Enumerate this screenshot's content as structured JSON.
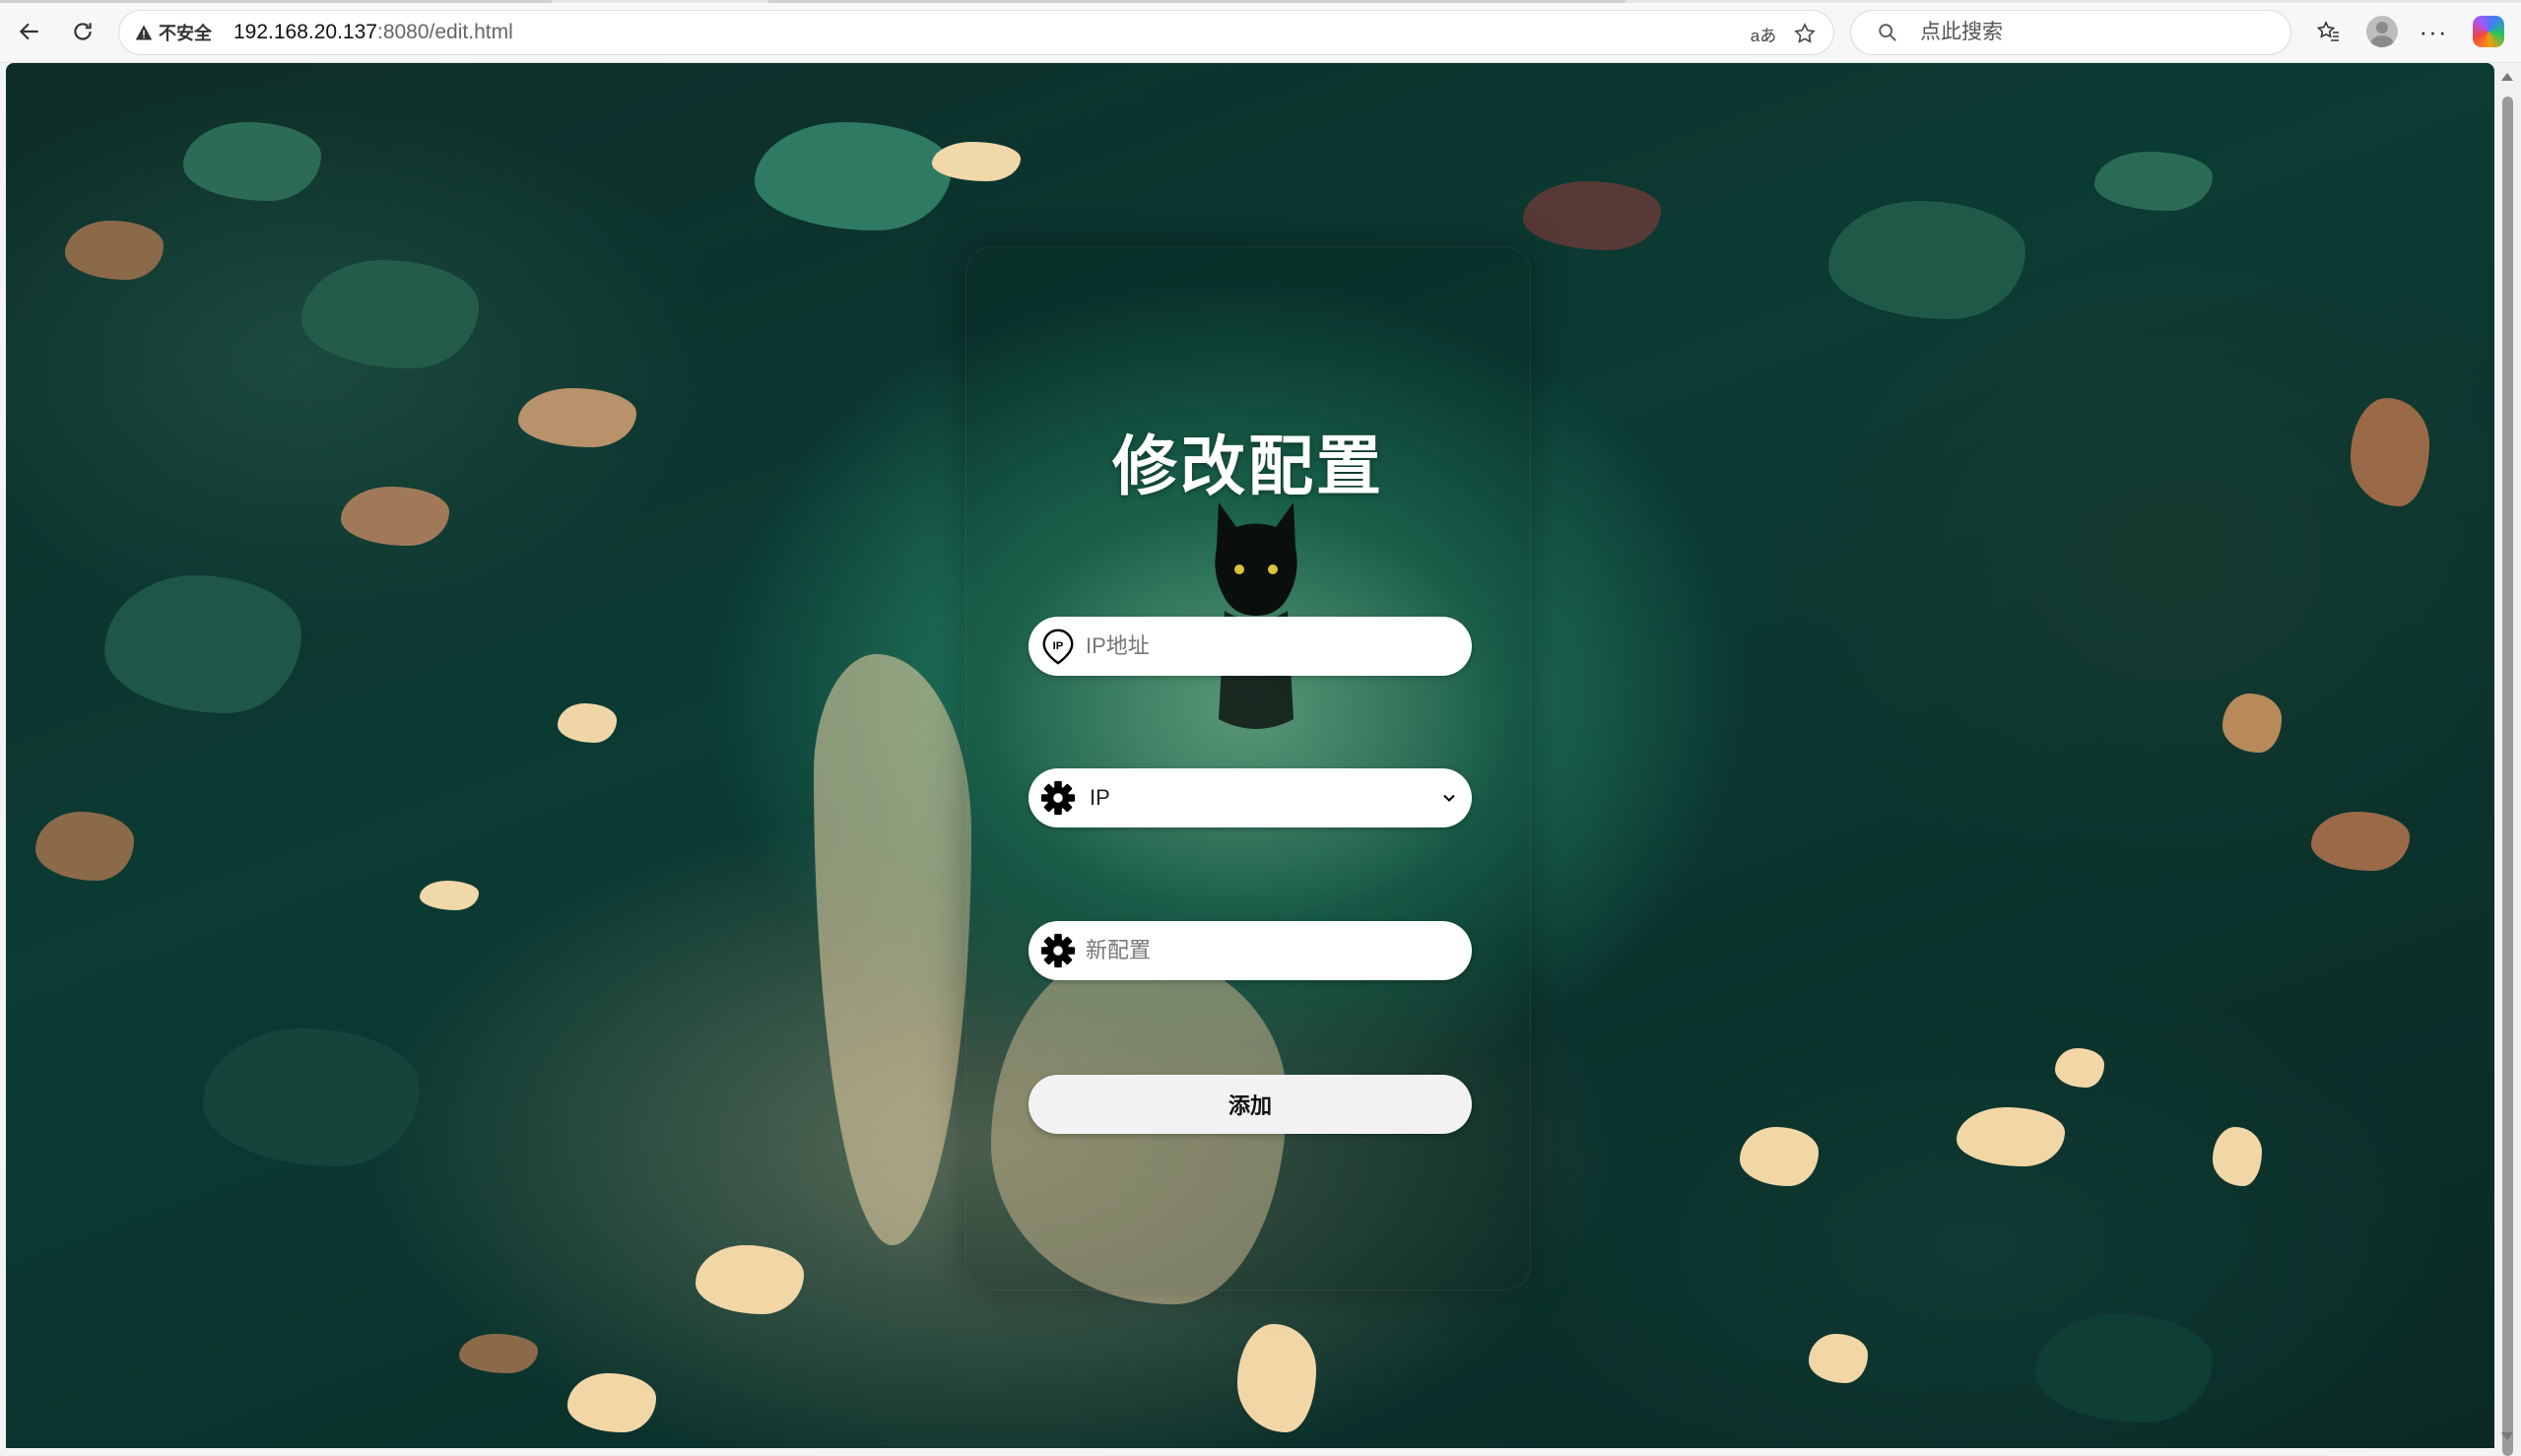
{
  "browser": {
    "security_label": "不安全",
    "url_host": "192.168.20.137",
    "url_rest": ":8080/edit.html",
    "search_placeholder": "点此搜索",
    "read_aloud_icon": "aあ"
  },
  "page": {
    "title": "修改配置",
    "ip_field": {
      "placeholder": "IP地址",
      "value": ""
    },
    "type_select": {
      "selected": "IP"
    },
    "config_field": {
      "placeholder": "新配置",
      "value": ""
    },
    "submit_label": "添加"
  },
  "colors": {
    "card_tint": "#00140f",
    "button_bg": "#f2f2f2",
    "field_bg": "#ffffff",
    "title_color": "#ffffff"
  }
}
